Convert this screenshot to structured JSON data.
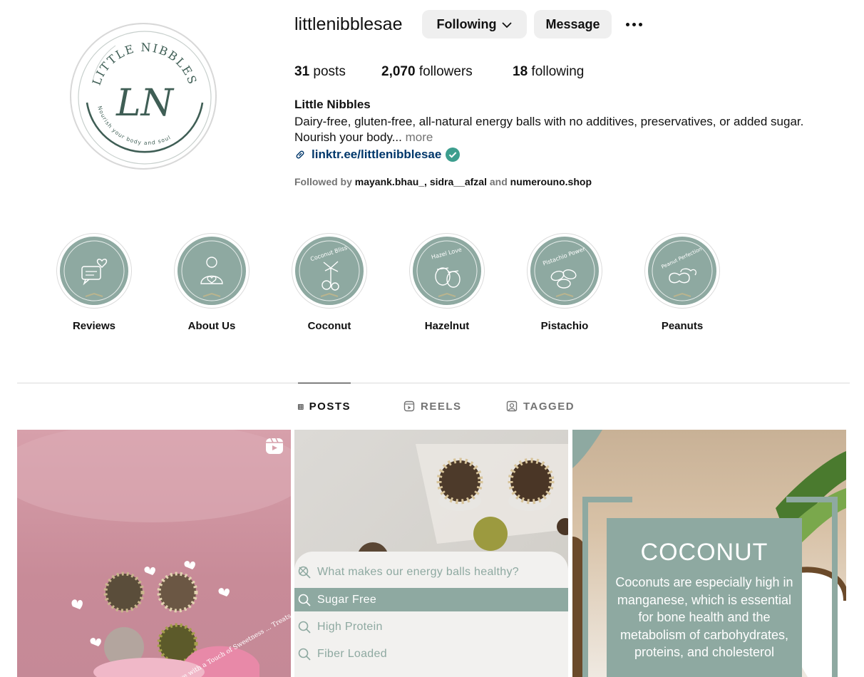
{
  "profile": {
    "username": "littlenibblesae",
    "following_button": "Following",
    "message_button": "Message",
    "logo_text": "LITTLE NIBBLES",
    "logo_monogram": "LN",
    "logo_tagline": "Nourish your body and soul",
    "stats": {
      "posts_count": "31",
      "posts_label": "posts",
      "followers_count": "2,070",
      "followers_label": "followers",
      "following_count": "18",
      "following_label": "following"
    },
    "full_name": "Little Nibbles",
    "bio_text": "Dairy-free, gluten-free, all-natural energy balls with no additives, preservatives, or added sugar. Nourish your body...",
    "bio_more": "more",
    "link_text": "linktr.ee/littlenibblesae",
    "followed_by_prefix": "Followed by",
    "followed_by_accounts": [
      "mayank.bhau_",
      "sidra__afzal",
      "numerouno.shop"
    ],
    "followed_by_sep": ",",
    "followed_by_and": "and"
  },
  "highlights": [
    {
      "label": "Reviews",
      "cover_text": "",
      "icon": "chat-heart-icon"
    },
    {
      "label": "About Us",
      "cover_text": "",
      "icon": "person-heart-icon"
    },
    {
      "label": "Coconut",
      "cover_text": "Coconut Bliss",
      "icon": "palm-coconut-icon"
    },
    {
      "label": "Hazelnut",
      "cover_text": "Hazel Love",
      "icon": "hazelnut-icon"
    },
    {
      "label": "Pistachio",
      "cover_text": "Pistachio Power",
      "icon": "pistachio-icon"
    },
    {
      "label": "Peanuts",
      "cover_text": "Peanut Perfection",
      "icon": "peanut-icon"
    }
  ],
  "tabs": {
    "posts": "POSTS",
    "reels": "REELS",
    "tagged": "TAGGED"
  },
  "posts": {
    "post1": {
      "type_icon": "reel-icon",
      "caption": "Celebrate Love with a Touch of Sweetness ... Treats"
    },
    "post2": {
      "question": "What makes our energy balls healthy?",
      "options": [
        "Sugar Free",
        "High Protein",
        "Fiber Loaded"
      ]
    },
    "post3": {
      "title": "COCONUT",
      "body": "Coconuts are especially high in manganese, which is essential for bone health and the metabolism of carbohydrates, proteins, and cholesterol"
    }
  },
  "colors": {
    "sage": "#8ea9a1",
    "link": "#00376b",
    "verified": "#3c9e8e",
    "button_bg": "#efefef",
    "muted": "#737373"
  }
}
